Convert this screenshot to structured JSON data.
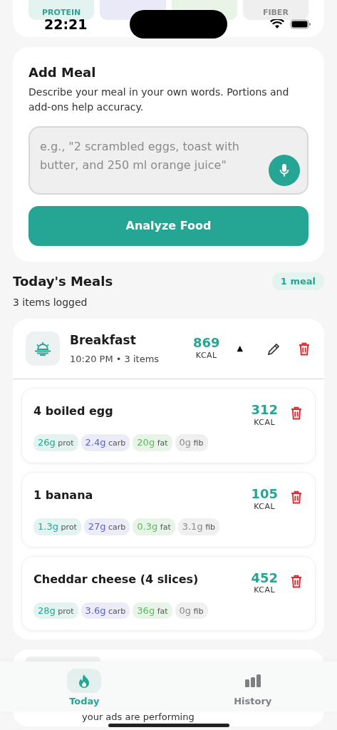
{
  "status_bar": {
    "time": "22:21"
  },
  "summary_tiles": [
    {
      "kind": "protein",
      "label": "PROTEIN"
    },
    {
      "kind": "carbs"
    },
    {
      "kind": "fat"
    },
    {
      "kind": "fiber",
      "label": "FIBER"
    }
  ],
  "add_meal": {
    "title": "Add Meal",
    "description": "Describe your meal in your own words. Portions and add-ons help accuracy.",
    "placeholder": "e.g., \"2 scrambled eggs, toast with butter, and 250 ml orange juice\"",
    "button": "Analyze Food"
  },
  "meals_header": {
    "title": "Today's Meals",
    "count_badge": "1 meal",
    "subtitle": "3 items logged"
  },
  "meals": [
    {
      "name": "Breakfast",
      "meta": "10:20 PM • 3 items",
      "kcal": "869",
      "kcal_label": "KCAL",
      "caret": "▲",
      "expanded": true,
      "items": [
        {
          "name": "4 boiled egg",
          "kcal": "312",
          "kcal_label": "KCAL",
          "macros": [
            {
              "kind": "prot",
              "value": "26g",
              "unit": "prot"
            },
            {
              "kind": "carb",
              "value": "2.4g",
              "unit": "carb"
            },
            {
              "kind": "fat",
              "value": "20g",
              "unit": "fat"
            },
            {
              "kind": "fib",
              "value": "0g",
              "unit": "fib"
            }
          ]
        },
        {
          "name": "1 banana",
          "kcal": "105",
          "kcal_label": "KCAL",
          "macros": [
            {
              "kind": "prot",
              "value": "1.3g",
              "unit": "prot"
            },
            {
              "kind": "carb",
              "value": "27g",
              "unit": "carb"
            },
            {
              "kind": "fat",
              "value": "0.3g",
              "unit": "fat"
            },
            {
              "kind": "fib",
              "value": "3.1g",
              "unit": "fib"
            }
          ]
        },
        {
          "name": "Cheddar cheese (4 slices)",
          "kcal": "452",
          "kcal_label": "KCAL",
          "macros": [
            {
              "kind": "prot",
              "value": "28g",
              "unit": "prot"
            },
            {
              "kind": "carb",
              "value": "3.6g",
              "unit": "carb"
            },
            {
              "kind": "fat",
              "value": "36g",
              "unit": "fat"
            },
            {
              "kind": "fib",
              "value": "0g",
              "unit": "fib"
            }
          ]
        }
      ]
    }
  ],
  "ad": {
    "text": "your ads are performing"
  },
  "tabs": [
    {
      "label": "Today",
      "kind": "flame",
      "selected": true
    },
    {
      "label": "History",
      "kind": "bars",
      "selected": false
    }
  ]
}
